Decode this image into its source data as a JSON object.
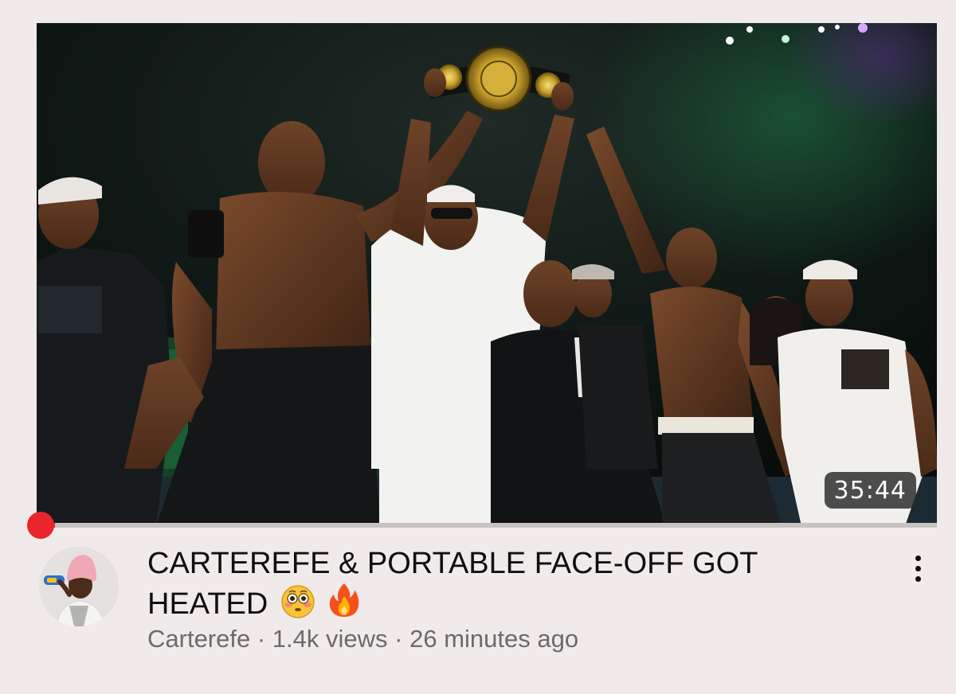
{
  "video": {
    "duration": "35:44",
    "progress_fraction": 0.02,
    "title_line1": "CARTEREFE & PORTABLE FACE-OFF GOT",
    "title_line2": "HEATED",
    "title_emojis": [
      "flushed-face-icon",
      "fire-icon"
    ],
    "channel": "Carterefe",
    "views": "1.4k views",
    "age": "26 minutes ago",
    "separator": " · "
  },
  "colors": {
    "accent_red": "#e8262b",
    "background": "#f0eaea",
    "title_text": "#0f0f0f",
    "meta_text": "#6b6b6b"
  },
  "icons": {
    "menu": "more-vertical-icon"
  }
}
